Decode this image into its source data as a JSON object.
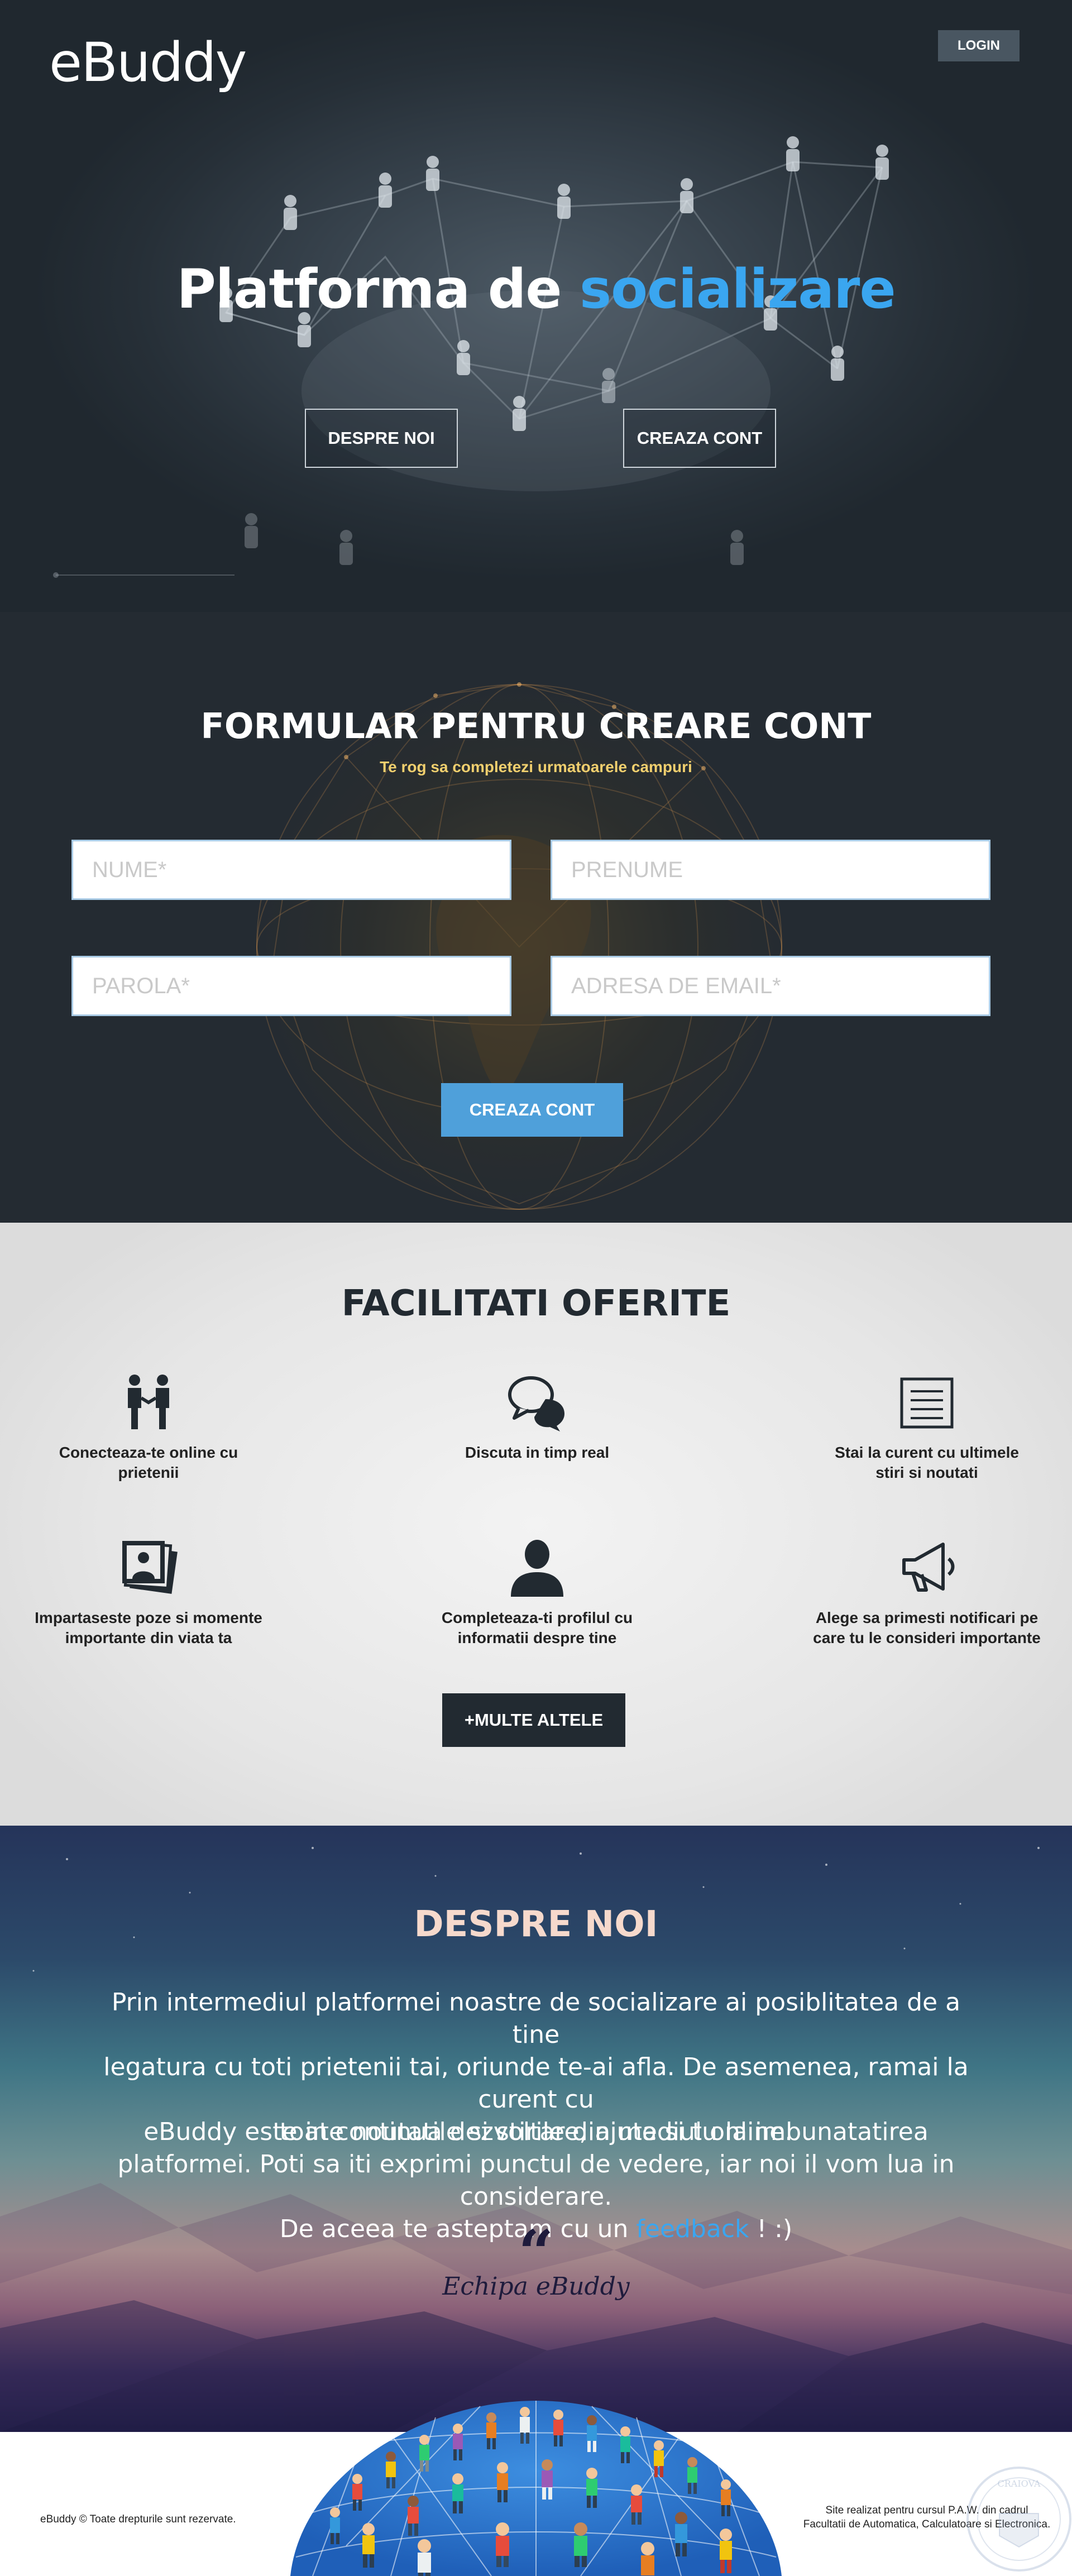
{
  "header": {
    "logo": "eBuddy",
    "login_label": "LOGIN"
  },
  "hero": {
    "title_part1": "Platforma de ",
    "title_accent": "socializare",
    "about_btn": "DESPRE NOI",
    "create_btn": "CREAZA CONT"
  },
  "signup": {
    "title": "FORMULAR PENTRU CREARE CONT",
    "subtitle": "Te rog sa completezi urmatoarele campuri",
    "first_name_placeholder": "NUME*",
    "last_name_placeholder": "PRENUME",
    "password_placeholder": "PAROLA*",
    "email_placeholder": "ADRESA DE EMAIL*",
    "submit_label": "CREAZA CONT"
  },
  "features": {
    "title": "FACILITATI OFERITE",
    "items": [
      {
        "icon": "people-icon",
        "label_l1": "Conecteaza-te online cu",
        "label_l2": "prietenii"
      },
      {
        "icon": "chat-bubbles-icon",
        "label_l1": "Discuta in timp real",
        "label_l2": ""
      },
      {
        "icon": "news-icon",
        "label_l1": "Stai la curent cu ultimele",
        "label_l2": "stiri si noutati"
      },
      {
        "icon": "photos-icon",
        "label_l1": "Impartaseste poze si momente",
        "label_l2": "importante din viata ta"
      },
      {
        "icon": "user-profile-icon",
        "label_l1": "Completeaza-ti profilul cu",
        "label_l2": "informatii despre tine"
      },
      {
        "icon": "megaphone-icon",
        "label_l1": "Alege sa primesti notificari pe",
        "label_l2": "care tu le consideri importante"
      }
    ],
    "more_label": "+MULTE ALTELE"
  },
  "about": {
    "title": "DESPRE NOI",
    "p1_l1": "Prin intermediul platformei noastre de socializare ai posiblitatea de a tine",
    "p1_l2": "legatura cu toti prietenii tai, oriunde te-ai afla. De asemenea, ramai la curent cu",
    "p1_l3": "toate noutatile si stirile din mediul online.",
    "p2_l1": "eBuddy este in continua dezvoltare, ajuta si tu la imbunatatirea",
    "p2_l2": "platformei. Poti sa iti exprimi punctul de vedere,  iar noi il vom lua in considerare.",
    "p2_l3_before": "De aceea te asteptam cu un ",
    "p2_link": "feedback",
    "p2_l3_after": " ! :)",
    "quote_mark": "“",
    "signature": "Echipa eBuddy"
  },
  "footer": {
    "copyright": "eBuddy © Toate drepturile sunt rezervate.",
    "credit_l1": "Site realizat pentru cursul P.A.W. din cadrul",
    "credit_l2": "Facultatii de Automatica, Calculatoare si Electronica.",
    "seal_text": "CRAIOVA"
  },
  "colors": {
    "accent_blue": "#3aa6f0",
    "dark_slate": "#222a31",
    "button_blue": "#4fa0da",
    "subtitle_gold": "#f0cf6e"
  }
}
